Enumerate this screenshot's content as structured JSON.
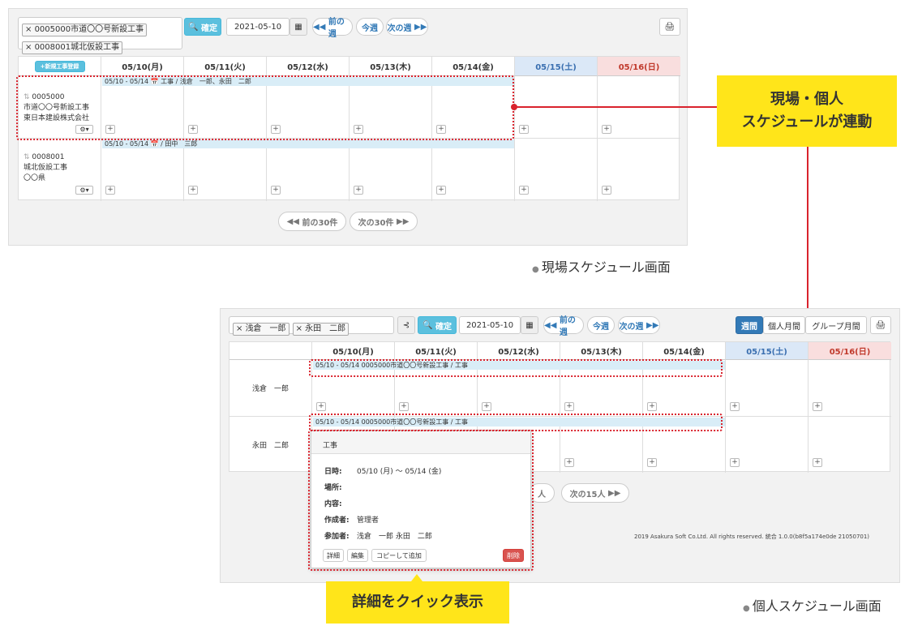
{
  "top": {
    "tags": [
      "0005000市道〇〇号新設工事",
      "0008001城北仮設工事"
    ],
    "confirm": "確定",
    "date": "2021-05-10",
    "prev_week": "前の週",
    "this_week": "今週",
    "next_week": "次の週",
    "new_btn": "新規工事登録",
    "days": [
      "05/10(月)",
      "05/11(火)",
      "05/12(水)",
      "05/13(木)",
      "05/14(金)",
      "05/15(土)",
      "05/16(日)"
    ],
    "rows": [
      {
        "lines": [
          "0005000",
          "市道〇〇号新設工事",
          "東日本建設株式会社"
        ],
        "event": "05/10 - 05/14 📅 工事 / 浅倉　一郎、永田　二郎"
      },
      {
        "lines": [
          "0008001",
          "城北仮設工事",
          "〇〇県"
        ],
        "event": "05/10 - 05/14 📅 / 田中　三郎"
      }
    ],
    "prev_page": "前の30件",
    "next_page": "次の30件"
  },
  "callout1": [
    "現場・個人",
    "スケジュールが連動"
  ],
  "caption1": "現場スケジュール画面",
  "bottom": {
    "tags": [
      "浅倉　一郎",
      "永田　二郎"
    ],
    "confirm": "確定",
    "date": "2021-05-10",
    "prev_week": "前の週",
    "this_week": "今週",
    "next_week": "次の週",
    "view_week": "週間",
    "view_personal": "個人月間",
    "view_group": "グループ月間",
    "days": [
      "05/10(月)",
      "05/11(火)",
      "05/12(水)",
      "05/13(木)",
      "05/14(金)",
      "05/15(土)",
      "05/16(日)"
    ],
    "rows": [
      {
        "name": "浅倉　一郎",
        "event": "05/10 - 05/14 0005000市道〇〇号新設工事 / 工事"
      },
      {
        "name": "永田　二郎",
        "event": "05/10 - 05/14 0005000市道〇〇号新設工事 / 工事"
      }
    ],
    "prev_page": "人",
    "next_page": "次の15人",
    "footer": "2019 Asakura Soft Co.Ltd. All rights reserved. 統合 1.0.0(b8f5a174e0de 21050701)"
  },
  "popup": {
    "title": "工事",
    "date_label": "日時:",
    "date_value": "05/10 (月) 〜 05/14 (金)",
    "place_label": "場所:",
    "content_label": "内容:",
    "author_label": "作成者:",
    "author_value": "管理者",
    "members_label": "参加者:",
    "members_value": "浅倉　一郎 永田　二郎",
    "btn_detail": "詳細",
    "btn_edit": "編集",
    "btn_copy": "コピーして追加",
    "btn_delete": "削除"
  },
  "callout2": "詳細をクイック表示",
  "caption2": "個人スケジュール画面"
}
